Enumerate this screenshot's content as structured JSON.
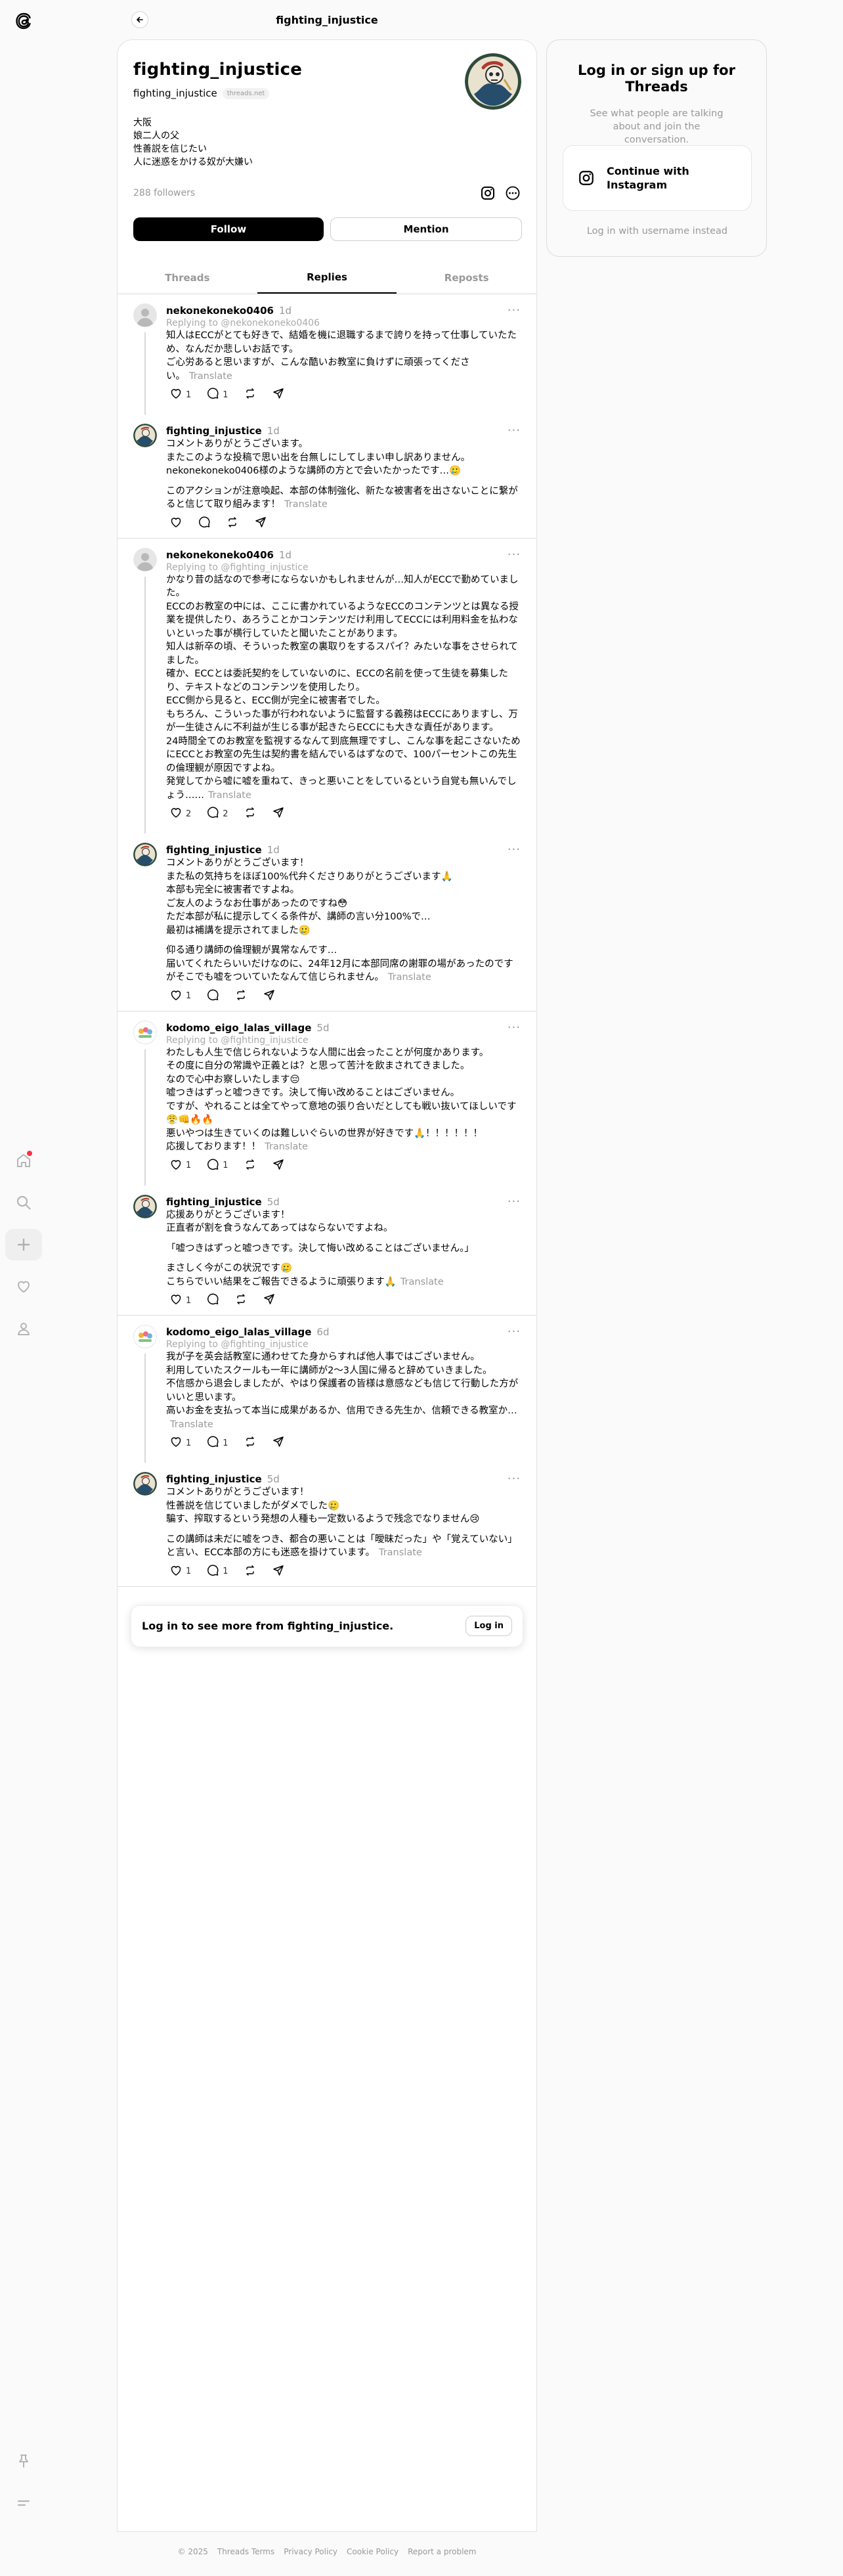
{
  "header": {
    "title": "fighting_injustice"
  },
  "profile": {
    "name": "fighting_injustice",
    "handle": "fighting_injustice",
    "badge": "threads.net",
    "bio": [
      "大阪",
      "娘二人の父",
      "性善説を信じたい",
      "人に迷惑をかける奴が大嫌い"
    ],
    "followers": "288 followers",
    "follow_label": "Follow",
    "mention_label": "Mention"
  },
  "tabs": [
    {
      "label": "Threads",
      "active": false
    },
    {
      "label": "Replies",
      "active": true
    },
    {
      "label": "Reposts",
      "active": false
    }
  ],
  "translate_label": "Translate",
  "groups": [
    {
      "parent": {
        "user": "nekonekoneko0406",
        "time": "1d",
        "avatar": "default",
        "replying": "Replying to @nekonekoneko0406",
        "paragraphs": [
          [
            "知人はECCがとても好きで、結婚を機に退職するまで誇りを持って仕事していたため、なんだか悲しいお話です。",
            "ご心労あると思いますが、こんな酷いお教室に負けずに頑張ってくださ",
            "い。"
          ]
        ],
        "likes": "1",
        "replies": "1"
      },
      "reply": {
        "user": "fighting_injustice",
        "time": "1d",
        "avatar": "profile",
        "paragraphs": [
          [
            "コメントありがとうございます。",
            "またこのような投稿で思い出を台無しにしてしまい申し訳ありません。",
            "nekonekoneko0406様のような講師の方とで会いたかったです…🥲"
          ],
          [
            "このアクションが注意喚起、本部の体制強化、新たな被害者を出さないことに繋がると信じて取り組みます！"
          ]
        ],
        "likes": "",
        "replies": ""
      }
    },
    {
      "parent": {
        "user": "nekonekoneko0406",
        "time": "1d",
        "avatar": "default",
        "replying": "Replying to @fighting_injustice",
        "paragraphs": [
          [
            "かなり昔の話なので参考にならないかもしれませんが…知人がECCで勤めていました。",
            "ECCのお教室の中には、ここに書かれているようなECCのコンテンツとは異なる授業を提供したり、あろうことかコンテンツだけ利用してECCには利用料金を払わないといった事が横行していたと聞いたことがあります。",
            "知人は新卒の頃、そういった教室の裏取りをするスパイ？みたいな事をさせられてました。",
            "確か、ECCとは委託契約をしていないのに、ECCの名前を使って生徒を募集したり、テキストなどのコンテンツを使用したり。",
            "ECC側から見ると、ECC側が完全に被害者でした。",
            "もちろん、こういった事が行われないように監督する義務はECCにありますし、万が一生徒さんに不利益が生じる事が起きたらECCにも大きな責任があります。",
            "24時間全てのお教室を監視するなんて到底無理ですし、こんな事を起こさないためにECCとお教室の先生は契約書を結んでいるはずなので、100パーセントこの先生の倫理観が原因ですよね。",
            "発覚してから嘘に嘘を重ねて、きっと悪いことをしているという自覚も無いんでしょう……"
          ]
        ],
        "likes": "2",
        "replies": "2"
      },
      "reply": {
        "user": "fighting_injustice",
        "time": "1d",
        "avatar": "profile",
        "paragraphs": [
          [
            "コメントありがとうございます！",
            "また私の気持ちをほぼ100%代弁くださりありがとうございます🙏",
            "本部も完全に被害者ですよね。",
            "ご友人のようなお仕事があったのですね😳",
            "ただ本部が私に提示してくる条件が、講師の言い分100%で…",
            "最初は補講を提示されてました🥲"
          ],
          [
            "仰る通り講師の倫理観が異常なんです…",
            "届いてくれたらいいだけなのに、24年12月に本部同席の謝罪の場があったのですがそこでも嘘をついていたなんて信じられません。"
          ]
        ],
        "likes": "1",
        "replies": ""
      }
    },
    {
      "parent": {
        "user": "kodomo_eigo_lalas_village",
        "time": "5d",
        "avatar": "lala",
        "replying": "Replying to @fighting_injustice",
        "paragraphs": [
          [
            "わたしも人生で信じられないような人間に出会ったことが何度かあります。",
            "その度に自分の常識や正義とは？と思って苦汁を飲まされてきました。",
            "なので心中お察しいたします😔",
            "嘘つきはずっと嘘つきです。決して悔い改めることはございません。",
            "ですが、やれることは全てやって意地の張り合いだとしても戦い抜いてほしいです😤👊🔥🔥",
            "悪いやつは生きていくのは難しいぐらいの世界が好きです🙏！！！！！！",
            "応援しております！！"
          ]
        ],
        "likes": "1",
        "replies": "1"
      },
      "reply": {
        "user": "fighting_injustice",
        "time": "5d",
        "avatar": "profile",
        "paragraphs": [
          [
            "応援ありがとうございます！",
            "正直者が割を食うなんてあってはならないですよね。"
          ],
          [
            "「嘘つきはずっと嘘つきです。決して悔い改めることはございません。」"
          ],
          [
            "まさしく今がこの状況です🥲",
            "こちらでいい結果をご報告できるように頑張ります🙏"
          ]
        ],
        "likes": "1",
        "replies": ""
      }
    },
    {
      "parent": {
        "user": "kodomo_eigo_lalas_village",
        "time": "6d",
        "avatar": "lala",
        "replying": "Replying to @fighting_injustice",
        "paragraphs": [
          [
            "我が子を英会話教室に通わせてた身からすれば他人事ではございません。",
            "利用していたスクールも一年に講師が2〜3人国に帰ると辞めていきました。",
            "不信感から退会しましたが、やはり保護者の皆様は意感なども信じて行動した方がいいと思います。",
            "高いお金を支払って本当に成果があるか、信用できる先生か、信頼できる教室か…"
          ]
        ],
        "likes": "1",
        "replies": "1"
      },
      "reply": {
        "user": "fighting_injustice",
        "time": "5d",
        "avatar": "profile",
        "paragraphs": [
          [
            "コメントありがとうございます！",
            "性善説を信じていましたがダメでした🥲",
            "騙す、搾取するという発想の人種も一定数いるようで残念でなりません😢"
          ],
          [
            "この講師は未だに嘘をつき、都合の悪いことは「曖昧だった」や「覚えていない」と言い、ECC本部の方にも迷惑を掛けています。"
          ]
        ],
        "likes": "1",
        "replies": "1"
      }
    }
  ],
  "login_prompt": {
    "text": "Log in to see more from fighting_injustice.",
    "button": "Log in"
  },
  "side": {
    "title": "Log in or sign up for Threads",
    "subtitle": "See what people are talking about and join the conversation.",
    "button": "Continue with Instagram",
    "link": "Log in with username instead"
  },
  "footer": [
    "© 2025",
    "Threads Terms",
    "Privacy Policy",
    "Cookie Policy",
    "Report a problem"
  ],
  "colors": {
    "accent": "#000000",
    "muted": "#999999",
    "notification": "#ff3040"
  }
}
